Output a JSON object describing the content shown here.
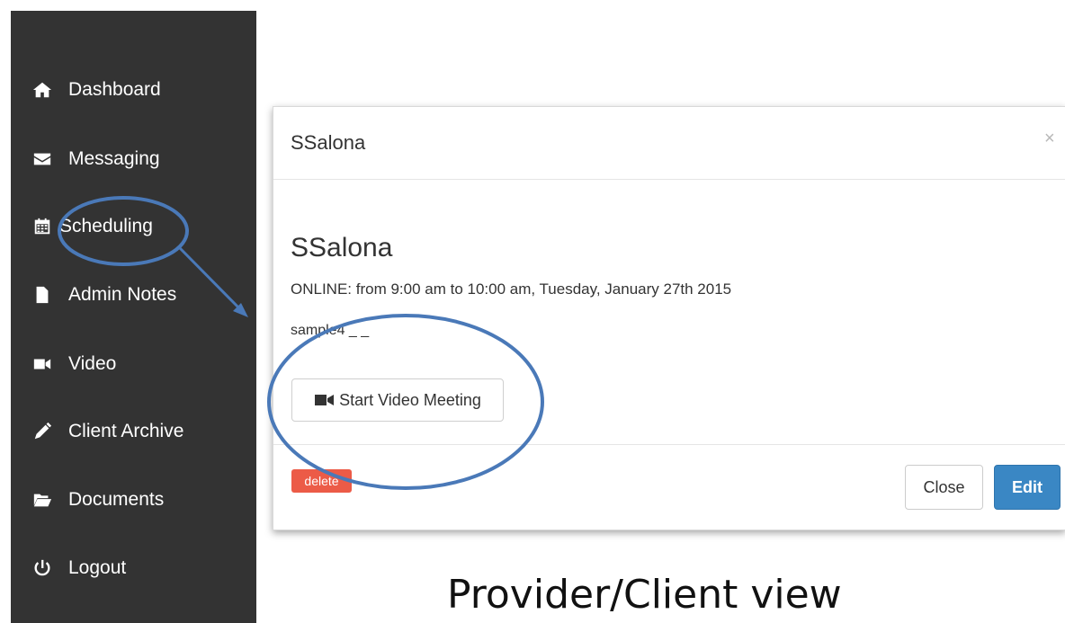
{
  "sidebar": {
    "items": [
      {
        "label": "Dashboard",
        "icon": "home-icon"
      },
      {
        "label": "Messaging",
        "icon": "envelope-icon"
      },
      {
        "label": "Scheduling",
        "icon": "calendar-icon"
      },
      {
        "label": "Admin Notes",
        "icon": "file-icon"
      },
      {
        "label": "Video",
        "icon": "video-camera-icon"
      },
      {
        "label": "Client Archive",
        "icon": "pencil-icon"
      },
      {
        "label": "Documents",
        "icon": "folder-open-icon"
      },
      {
        "label": "Logout",
        "icon": "power-icon"
      }
    ]
  },
  "modal": {
    "header_title": "SSalona",
    "close_symbol": "×",
    "title": "SSalona",
    "time": "ONLINE: from 9:00 am to 10:00 am, Tuesday, January 27th 2015",
    "note": "sample4 _ _",
    "video_button": "Start Video Meeting",
    "delete_button": "delete",
    "close_button": "Close",
    "edit_button": "Edit"
  },
  "caption": "Provider/Client view",
  "colors": {
    "sidebar_bg": "#333333",
    "annotation": "#4a79b8",
    "edit_button": "#3a87c4",
    "delete_button": "#ec5b47"
  }
}
